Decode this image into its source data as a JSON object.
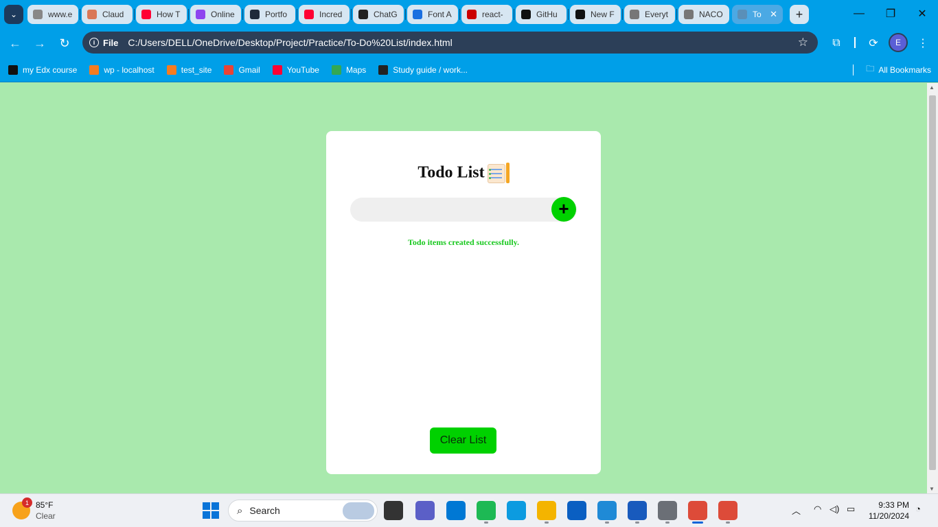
{
  "browser": {
    "tabs": [
      {
        "label": "www.e",
        "icon": "globe-icon",
        "color": "#888888"
      },
      {
        "label": "Claud",
        "icon": "claude-icon",
        "color": "#d97757"
      },
      {
        "label": "How T",
        "icon": "youtube-icon",
        "color": "#ff0033"
      },
      {
        "label": "Online",
        "icon": "online-icon",
        "color": "#8e44ef"
      },
      {
        "label": "Portfo",
        "icon": "react-icon",
        "color": "#1f2a3a"
      },
      {
        "label": "Incred",
        "icon": "youtube-icon",
        "color": "#ff0033"
      },
      {
        "label": "ChatG",
        "icon": "chatgpt-icon",
        "color": "#222222"
      },
      {
        "label": "Font A",
        "icon": "flag-icon",
        "color": "#1a6fe0"
      },
      {
        "label": "react-",
        "icon": "npm-icon",
        "color": "#cb0000"
      },
      {
        "label": "GitHu",
        "icon": "github-icon",
        "color": "#111111"
      },
      {
        "label": "New F",
        "icon": "triangle-icon",
        "color": "#111111"
      },
      {
        "label": "Everyt",
        "icon": "globe-icon",
        "color": "#777777"
      },
      {
        "label": "NACO",
        "icon": "globe-icon",
        "color": "#777777"
      },
      {
        "label": "To",
        "icon": "globe-icon",
        "color": "#5a8fb8",
        "active": true
      }
    ],
    "new_tab": "+",
    "url": "C:/Users/DELL/OneDrive/Desktop/Project/Practice/To-Do%20List/index.html",
    "site_chip": "File",
    "profile_initial": "E",
    "bookmarks": [
      {
        "label": "my Edx course",
        "icon": "edx-icon",
        "color": "#111111"
      },
      {
        "label": "wp - localhost",
        "icon": "xampp-icon",
        "color": "#f57c20"
      },
      {
        "label": "test_site",
        "icon": "xampp-icon",
        "color": "#f57c20"
      },
      {
        "label": "Gmail",
        "icon": "gmail-icon",
        "color": "#ea4335"
      },
      {
        "label": "YouTube",
        "icon": "youtube-icon",
        "color": "#ff0033"
      },
      {
        "label": "Maps",
        "icon": "maps-icon",
        "color": "#34a853"
      },
      {
        "label": "Study guide / work...",
        "icon": "bank-icon",
        "color": "#222222"
      }
    ],
    "all_bookmarks": "All Bookmarks"
  },
  "app": {
    "title": "Todo List",
    "input_value": "",
    "add_button": "+",
    "status_message": "Todo items created successfully.",
    "clear_button": "Clear List",
    "colors": {
      "background": "#a9e9ad",
      "accent": "#00d100",
      "message": "#19c81f"
    }
  },
  "taskbar": {
    "weather": {
      "temp": "85°F",
      "condition": "Clear",
      "badge": "1"
    },
    "search_label": "Search",
    "apps": [
      {
        "name": "task-view-icon",
        "color": "#333333"
      },
      {
        "name": "teams-icon",
        "color": "#5b5fc7"
      },
      {
        "name": "skype-icon",
        "color": "#0078d4"
      },
      {
        "name": "spotify-icon",
        "color": "#1db954"
      },
      {
        "name": "edge-icon",
        "color": "#0c9be0"
      },
      {
        "name": "file-explorer-icon",
        "color": "#f4b400"
      },
      {
        "name": "store-icon",
        "color": "#0a5fc2"
      },
      {
        "name": "vscode-icon",
        "color": "#1f8ad6"
      },
      {
        "name": "word-icon",
        "color": "#185abd"
      },
      {
        "name": "settings-icon",
        "color": "#6b6f76"
      },
      {
        "name": "chrome-icon",
        "color": "#dd4b39"
      },
      {
        "name": "chrome-profile-icon",
        "color": "#dd4b39"
      }
    ],
    "time": "9:33 PM",
    "date": "11/20/2024"
  }
}
